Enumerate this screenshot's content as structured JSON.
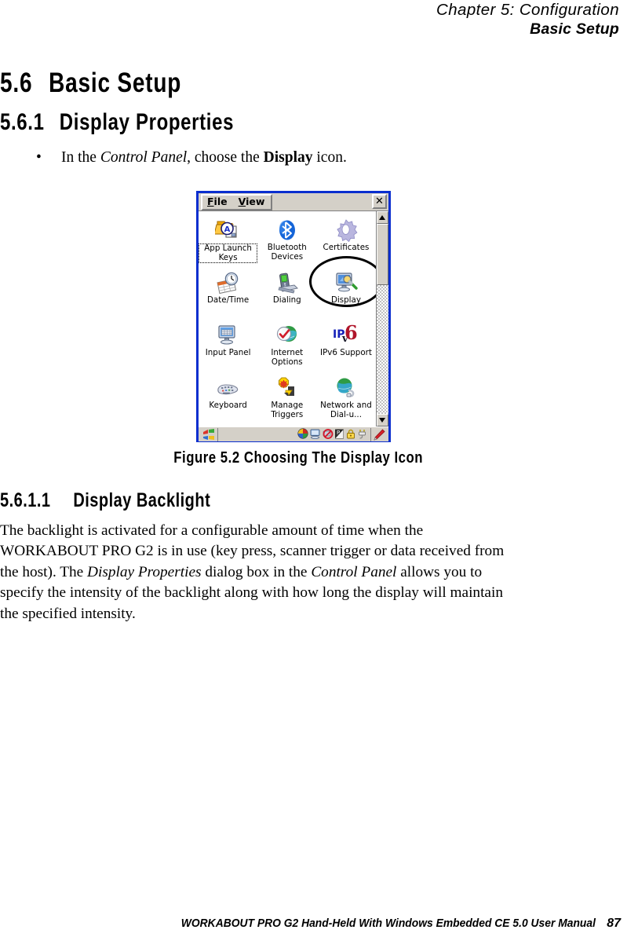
{
  "running_head": {
    "line1": "Chapter 5: Configuration",
    "line2": "Basic Setup"
  },
  "headings": {
    "h1_num": "5.6",
    "h1_text": "Basic Setup",
    "h2_num": "5.6.1",
    "h2_text": "Display Properties",
    "h3_num": "5.6.1.1",
    "h3_text": "Display Backlight"
  },
  "bullet": {
    "marker": "•",
    "t1": "In the ",
    "italic1": "Control Panel",
    "t2": ", choose the ",
    "bold1": "Display",
    "t3": " icon."
  },
  "figure": {
    "caption": "Figure 5.2 Choosing The Display Icon"
  },
  "paragraph": {
    "line1": "The backlight is activated for a configurable amount of time when the",
    "line2": "WORKABOUT PRO G2 is in use (key press, scanner trigger or data received from",
    "line3_a": "the host). The ",
    "line3_i": "Display Properties",
    "line3_b": " dialog box in the ",
    "line3_i2": "Control Panel",
    "line3_c": " allows you to",
    "line4": "specify the intensity of the backlight along with how long the display will maintain",
    "line5": "the specified intensity."
  },
  "footer": {
    "text": "WORKABOUT PRO G2 Hand-Held With Windows Embedded CE 5.0 User Manual",
    "page": "87"
  },
  "ce_window": {
    "menu": [
      {
        "label_u": "F",
        "label_rest": "ile",
        "name": "menu-file"
      },
      {
        "label_u": "V",
        "label_rest": "iew",
        "name": "menu-view"
      }
    ],
    "close_glyph": "✕",
    "icons": [
      {
        "label": "App Launch Keys",
        "icon": "app-launch-keys-icon",
        "selected": true
      },
      {
        "label": "Bluetooth Devices",
        "icon": "bluetooth-devices-icon",
        "selected": false
      },
      {
        "label": "Certificates",
        "icon": "certificates-icon",
        "selected": false
      },
      {
        "label": "Date/Time",
        "icon": "date-time-icon",
        "selected": false
      },
      {
        "label": "Dialing",
        "icon": "dialing-icon",
        "selected": false
      },
      {
        "label": "Display",
        "icon": "display-icon",
        "selected": false,
        "annotated": true
      },
      {
        "label": "Input Panel",
        "icon": "input-panel-icon",
        "selected": false
      },
      {
        "label": "Internet Options",
        "icon": "internet-options-icon",
        "selected": false
      },
      {
        "label": "IPv6 Support",
        "icon": "ipv6-support-icon",
        "selected": false
      },
      {
        "label": "Keyboard",
        "icon": "keyboard-icon",
        "selected": false
      },
      {
        "label": "Manage Triggers",
        "icon": "manage-triggers-icon",
        "selected": false
      },
      {
        "label": "Network and Dial-u...",
        "icon": "network-dialup-icon",
        "selected": false
      }
    ],
    "tray_icons": [
      "color-palette-icon",
      "desktop-monitor-icon",
      "no-connection-icon",
      "battery-icon",
      "lock-icon",
      "power-plug-icon"
    ],
    "stylus_icon": "stylus-pen-icon",
    "start_icon": "windows-start-icon"
  },
  "colors": {
    "window_border": "#0a2ecf",
    "window_chrome": "#d4d0c8",
    "bluetooth_blue": "#1565d8",
    "ipv6_red": "#c0152a",
    "annotation": "#000000"
  }
}
